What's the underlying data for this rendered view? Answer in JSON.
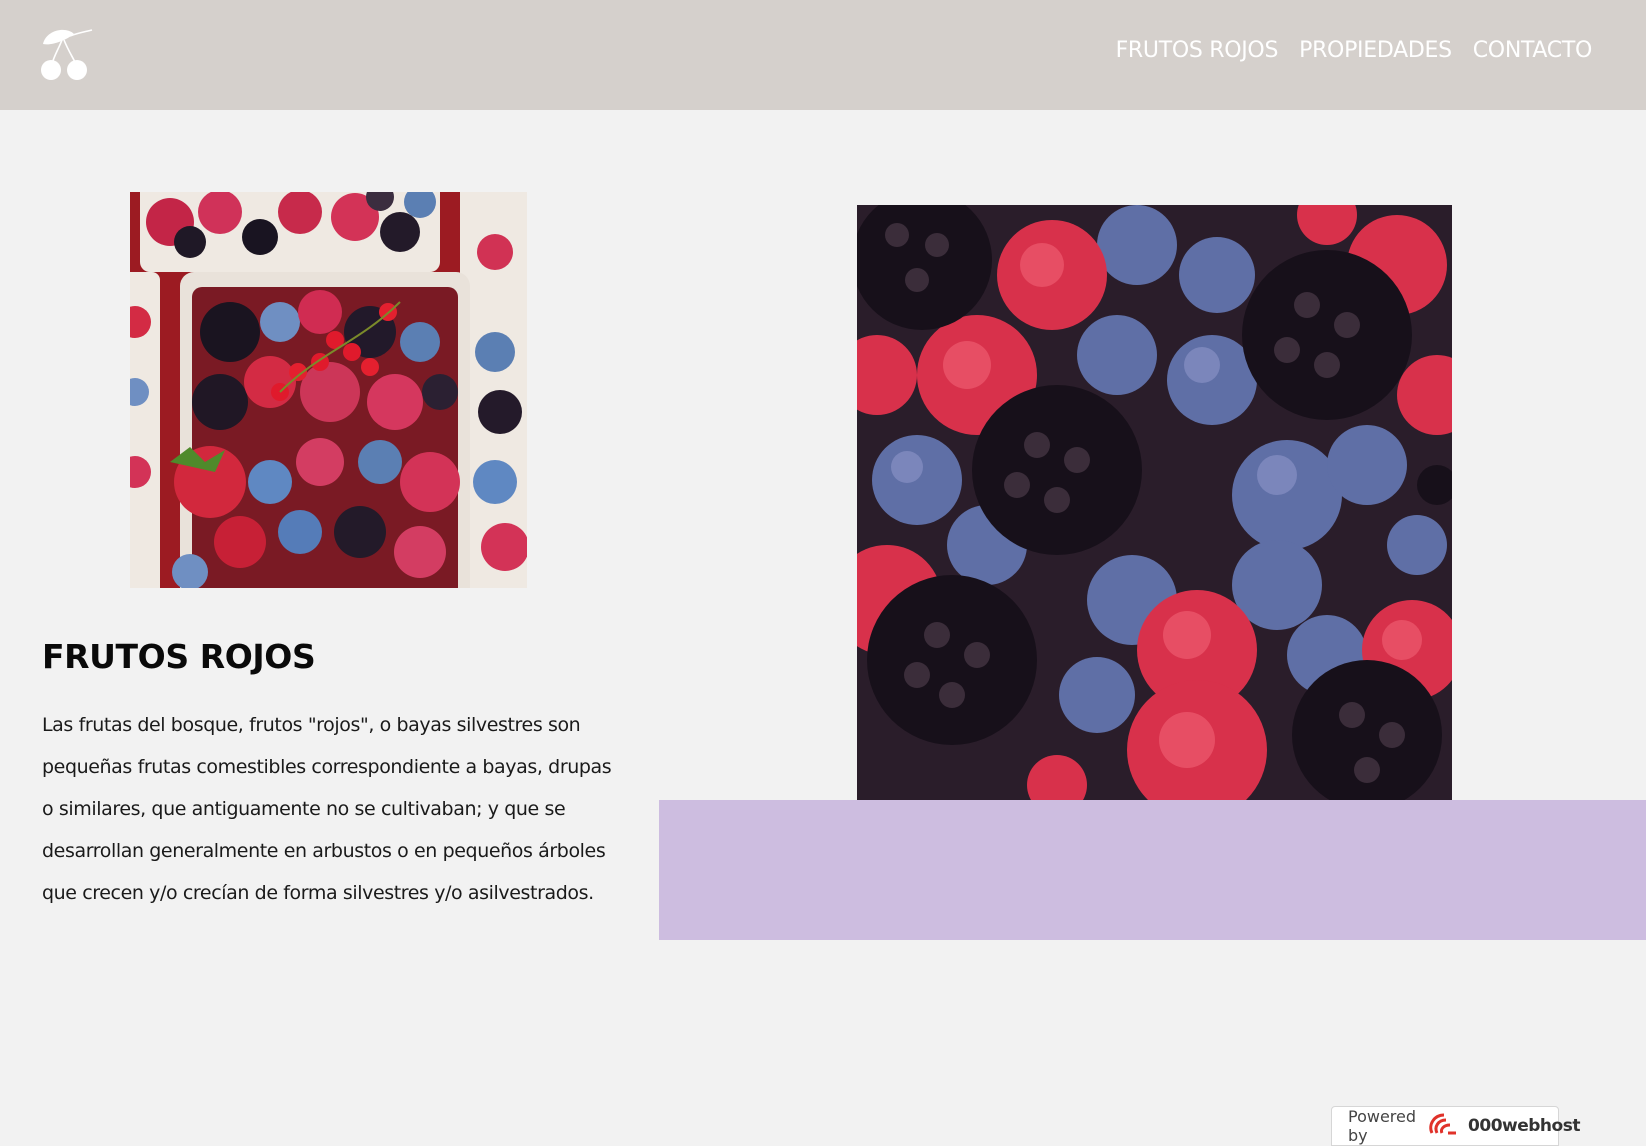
{
  "header": {
    "logo_icon": "cherry-icon",
    "background_color": "#d5d0cc",
    "nav": [
      {
        "label": "FRUTOS ROJOS"
      },
      {
        "label": "PROPIEDADES"
      },
      {
        "label": "CONTACTO"
      }
    ]
  },
  "main": {
    "thumbnail": {
      "icon": "berry-baskets-photo"
    },
    "title": "FRUTOS ROJOS",
    "paragraph": "Las frutas del bosque, frutos \"rojos\", o bayas silvestres son pequeñas frutas comestibles correspondiente a bayas, drupas o similares, que antiguamente no se cultivaban; y que se desarrollan generalmente en arbustos o en pequeños árboles que crecen y/o crecían de forma silvestres y/o asilvestrados.",
    "hero_image": {
      "icon": "mixed-berries-photo"
    },
    "accent_color": "#cdbde0"
  },
  "footer_badge": {
    "prefix": "Powered by",
    "brand": "000webhost",
    "icon": "000webhost-logo-icon"
  }
}
